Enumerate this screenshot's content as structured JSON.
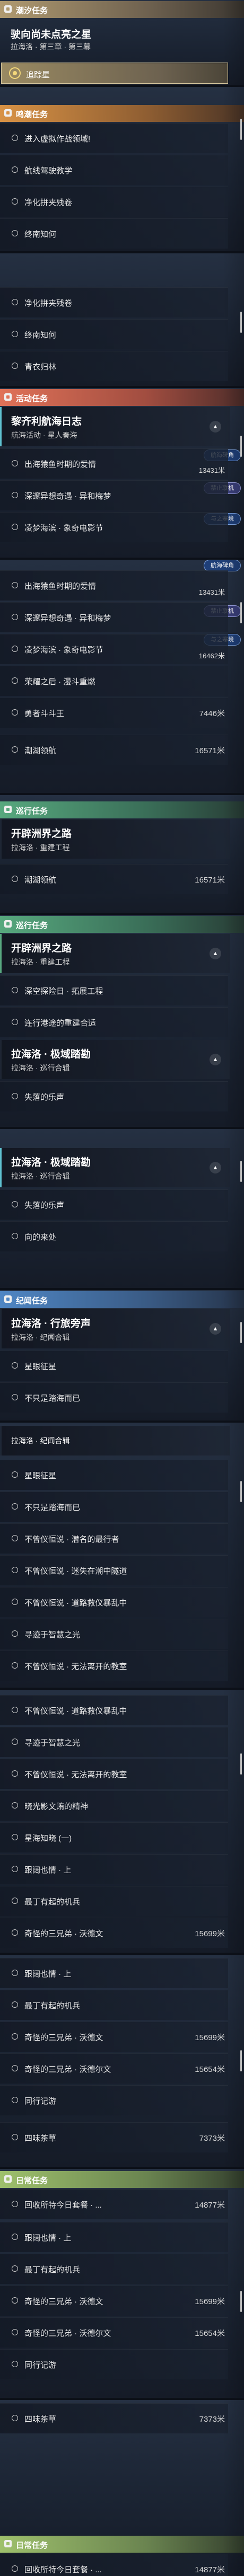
{
  "sections": {
    "main": "潮汐任务",
    "side": "鸣潮任务",
    "event": "活动任务",
    "roaming": "巡行任务",
    "commission": "纪闻任务",
    "daily": "日常任务"
  },
  "main_quest": {
    "title": "驶向尚未点亮之星",
    "subtitle": "拉海洛 · 第三章 · 第三幕",
    "navigate": "追踪星"
  },
  "side_items": [
    "进入虚拟作战领域!",
    "航线驾驶教学",
    "净化拼夹残卷",
    "终南知何"
  ],
  "seg2_items": [
    "净化拼夹残卷",
    "终南知何",
    "青衣归林"
  ],
  "event_quest": {
    "title": "黎齐利航海日志",
    "subtitle": "航海活动 · 星人奏海",
    "dist": "13431米"
  },
  "event_items": [
    {
      "label": "出海猿鱼时期的爱情",
      "tag": "航海碑角"
    },
    {
      "label": "深邃异想奇遇 · 异和梅梦",
      "tag": "禁止联机"
    },
    {
      "label": "凌梦海滨 · 象奇电影节",
      "tag": "与之寒境"
    }
  ],
  "event_dists": [
    "13431米",
    "16462米"
  ],
  "event2_items": [
    "出海猿鱼时期的爱情",
    "深邃异想奇遇 · 异和梅梦",
    "凌梦海滨 · 象奇电影节",
    "荣耀之后 · 漫斗重燃",
    "勇者斗斗王",
    "潮湖领航"
  ],
  "event2_dists": [
    "13431米",
    "16462米",
    "7446米",
    "16571米"
  ],
  "roam_quest1": {
    "title": "开辟洲界之路",
    "subtitle": "拉海洛 · 重建工程"
  },
  "roam_item1": {
    "label": "潮湖领航",
    "dist": "16571米"
  },
  "roam_quest2": {
    "title": "开辟洲界之路",
    "subtitle": "拉海洛 · 重建工程"
  },
  "roam_items2": [
    "深空探险日 · 拓展工程",
    "连行港途的重建合适"
  ],
  "roam_quest3": {
    "title": "拉海洛 · 极域踏勘",
    "subtitle": "拉海洛 · 巡行合辑"
  },
  "roam_items3": [
    "失落的乐声"
  ],
  "roam_quest4": {
    "title": "拉海洛 · 极域踏勘",
    "subtitle": "拉海洛 · 巡行合辑"
  },
  "roam_items4": [
    "失落的乐声",
    "向的来处"
  ],
  "comm_quest": {
    "title": "拉海洛 · 行旅旁声",
    "subtitle": "拉海洛 · 纪闻合辑"
  },
  "comm_items": [
    "星眼征星",
    "不只是踏海而已"
  ],
  "comm_quest2": {
    "title": "拉海洛 · 纪闻合辑",
    "subtitle": ""
  },
  "comm_items2": [
    "星眼征星",
    "不只是踏海而已",
    "不曾仪恒说 · 潜名的最行者",
    "不曾仪恒说 · 迷失在潮中隧道",
    "不曾仪恒说 · 道路救仪暴乱中",
    "寻迹于智慧之光",
    "不曾仪恒说 · 无法离开的教室"
  ],
  "comm_items3": [
    "不曾仪恒说 · 道路救仪暴乱中",
    "寻迹于智慧之光",
    "不曾仪恒说 · 无法离开的教室",
    "晓光影文贿的精神",
    "星海知晓 (一)",
    "跟阔也情 · 上",
    "最丁有起的机兵",
    "奇怪的三兄弟 · 沃德文"
  ],
  "comm_dists3": [
    "15699米"
  ],
  "comm_items4": [
    "跟阔也情 · 上",
    "最丁有起的机兵",
    "奇怪的三兄弟 · 沃德文",
    "奇怪的三兄弟 · 沃德尔文",
    "同行记游",
    "四味茶草"
  ],
  "comm_dists4": [
    "15699米",
    "15654米",
    "7373米"
  ],
  "daily_quest": {
    "title": "回收所特今日套餐 · ...",
    "dist": "14877米"
  },
  "daily_items": [
    "跟阔也情 · 上",
    "最丁有起的机兵",
    "奇怪的三兄弟 · 沃德文",
    "奇怪的三兄弟 · 沃德尔文",
    "同行记游",
    "四味茶草"
  ],
  "daily_dists": [
    "15699米",
    "15654米",
    "7373米"
  ],
  "daily_quest2": {
    "title": "回收所特今日套餐 · ...",
    "dist": "14877米"
  },
  "colors": {
    "main": "#b09a70",
    "side": "#d89245",
    "event": "#e07258",
    "roaming": "#57a87e",
    "commission": "#4f86c4",
    "daily": "#9ec06c",
    "navigate": "#f3d77a"
  }
}
